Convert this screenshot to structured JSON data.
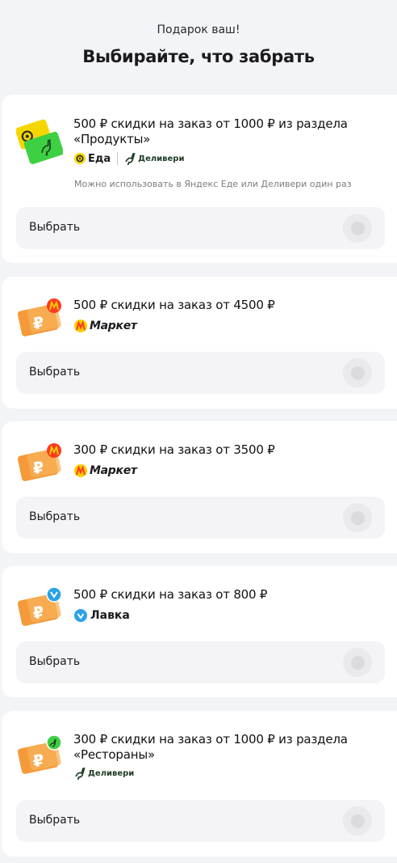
{
  "header": {
    "subtitle": "Подарок ваш!",
    "title": "Выбирайте, что забрать"
  },
  "offers": [
    {
      "title_line1": "500 ₽ скидки на заказ от 1000 ₽ из раздела",
      "title_line2": "«Продукты»",
      "brands": [
        "Еда",
        "Деливери"
      ],
      "note": "Можно использовать в Яндекс Еде или Деливери один раз",
      "choose_label": "Выбрать",
      "icon": "eda-delivery-coupon-icon"
    },
    {
      "title_line1": "500 ₽ скидки на заказ от 4500 ₽",
      "brand": "Маркет",
      "choose_label": "Выбрать",
      "icon": "market-coupon-icon"
    },
    {
      "title_line1": "300 ₽ скидки на заказ от 3500 ₽",
      "brand": "Маркет",
      "choose_label": "Выбрать",
      "icon": "market-coupon-icon"
    },
    {
      "title_line1": "500 ₽ скидки на заказ от 800 ₽",
      "brand": "Лавка",
      "choose_label": "Выбрать",
      "icon": "lavka-coupon-icon"
    },
    {
      "title_line1": "300 ₽ скидки на заказ от 1000 ₽ из раздела",
      "title_line2": "«Рестораны»",
      "brand": "Деливери",
      "choose_label": "Выбрать",
      "icon": "delivery-coupon-icon"
    }
  ],
  "colors": {
    "page_bg": "#f2f4f8",
    "card_bg": "#ffffff",
    "eda_yellow": "#f5d600",
    "delivery_green": "#3ed043",
    "coupon_orange": "#f59a3a",
    "market_red": "#ff3b1f",
    "lavka_blue": "#2ca2e6"
  }
}
